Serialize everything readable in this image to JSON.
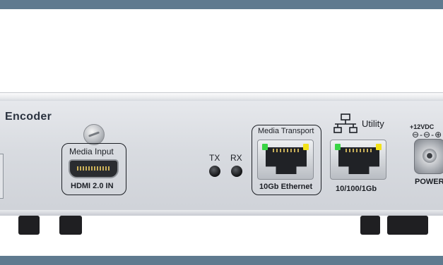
{
  "device": {
    "title": "Encoder",
    "colors": {
      "frame_bar": "#5f7a8f",
      "panel": "#d8dbe0",
      "led_green": "#39d445",
      "led_yellow": "#f2e21a"
    }
  },
  "ports": {
    "hdmi": {
      "group_label": "Media Input",
      "label": "HDMI 2.0 IN"
    },
    "media_transport": {
      "group_label": "Media Transport",
      "label": "10Gb Ethernet"
    },
    "utility": {
      "group_label": "Utility",
      "label": "10/100/1Gb",
      "icon": "network-icon"
    },
    "indicators": {
      "tx": "TX",
      "rx": "RX"
    },
    "power": {
      "voltage": "+12VDC",
      "label": "POWER",
      "polarity": "⊖-⊖-⊕"
    }
  }
}
